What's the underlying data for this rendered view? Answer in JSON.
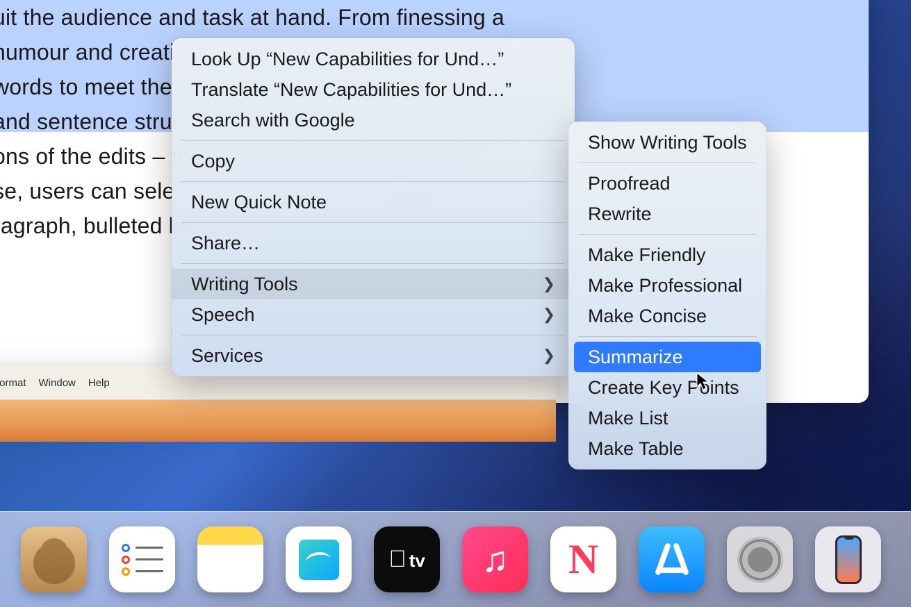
{
  "document": {
    "lines": [
      "uit the audience and task at hand. From finessing a",
      "humour and creativity, Rewrite helps deliver the right",
      "words to meet the occasion. Proofread checks",
      " and sentence structure, suggesting edits – along with",
      "ons of the edits – that users can review or quickly",
      "se, users can select text and have it recapped in",
      "ragraph, bulleted key points, a table, or a list."
    ]
  },
  "menubar": {
    "items": [
      "Format",
      "Window",
      "Help"
    ]
  },
  "context_menu": {
    "groups": [
      {
        "items": [
          {
            "label": "Look Up “New Capabilities for Und…”",
            "submenu": false
          },
          {
            "label": "Translate “New Capabilities for Und…”",
            "submenu": false
          },
          {
            "label": "Search with Google",
            "submenu": false
          }
        ]
      },
      {
        "items": [
          {
            "label": "Copy",
            "submenu": false
          }
        ]
      },
      {
        "items": [
          {
            "label": "New Quick Note",
            "submenu": false
          }
        ]
      },
      {
        "items": [
          {
            "label": "Share…",
            "submenu": false
          }
        ]
      },
      {
        "items": [
          {
            "label": "Writing Tools",
            "submenu": true,
            "highlighted": true
          },
          {
            "label": "Speech",
            "submenu": true
          }
        ]
      },
      {
        "items": [
          {
            "label": "Services",
            "submenu": true
          }
        ]
      }
    ]
  },
  "writing_tools_submenu": {
    "groups": [
      {
        "items": [
          {
            "label": "Show Writing Tools"
          }
        ]
      },
      {
        "items": [
          {
            "label": "Proofread"
          },
          {
            "label": "Rewrite"
          }
        ]
      },
      {
        "items": [
          {
            "label": "Make Friendly"
          },
          {
            "label": "Make Professional"
          },
          {
            "label": "Make Concise"
          }
        ]
      },
      {
        "items": [
          {
            "label": "Summarize",
            "highlighted": true
          },
          {
            "label": "Create Key Points"
          },
          {
            "label": "Make List"
          },
          {
            "label": "Make Table"
          }
        ]
      }
    ]
  },
  "dock": {
    "apps": [
      {
        "name": "Contacts"
      },
      {
        "name": "Reminders"
      },
      {
        "name": "Notes"
      },
      {
        "name": "Freeform"
      },
      {
        "name": "TV"
      },
      {
        "name": "Music"
      },
      {
        "name": "News"
      },
      {
        "name": "App Store"
      },
      {
        "name": "System Settings"
      },
      {
        "name": "iPhone Mirroring"
      }
    ]
  },
  "colors": {
    "highlight_blue": "#2f7bff",
    "selection_blue": "#b9d2ff"
  }
}
